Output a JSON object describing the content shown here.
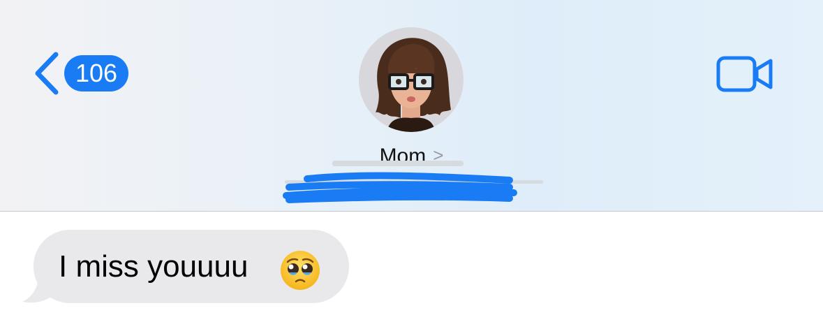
{
  "navigation": {
    "back_icon": "chevron-left-icon",
    "unread_count": "106",
    "accent_color": "#1a7cf5"
  },
  "contact": {
    "name": "Mom",
    "name_chevron": ">",
    "avatar": "memoji-avatar",
    "redacted_detail_color": "#1a7cf5"
  },
  "header_actions": {
    "video_call_icon": "video-camera-icon"
  },
  "messages": [
    {
      "direction": "incoming",
      "text": "I miss youuuu",
      "emoji": "pleading-face-emoji",
      "bubble_color": "#e9e9eb"
    }
  ]
}
